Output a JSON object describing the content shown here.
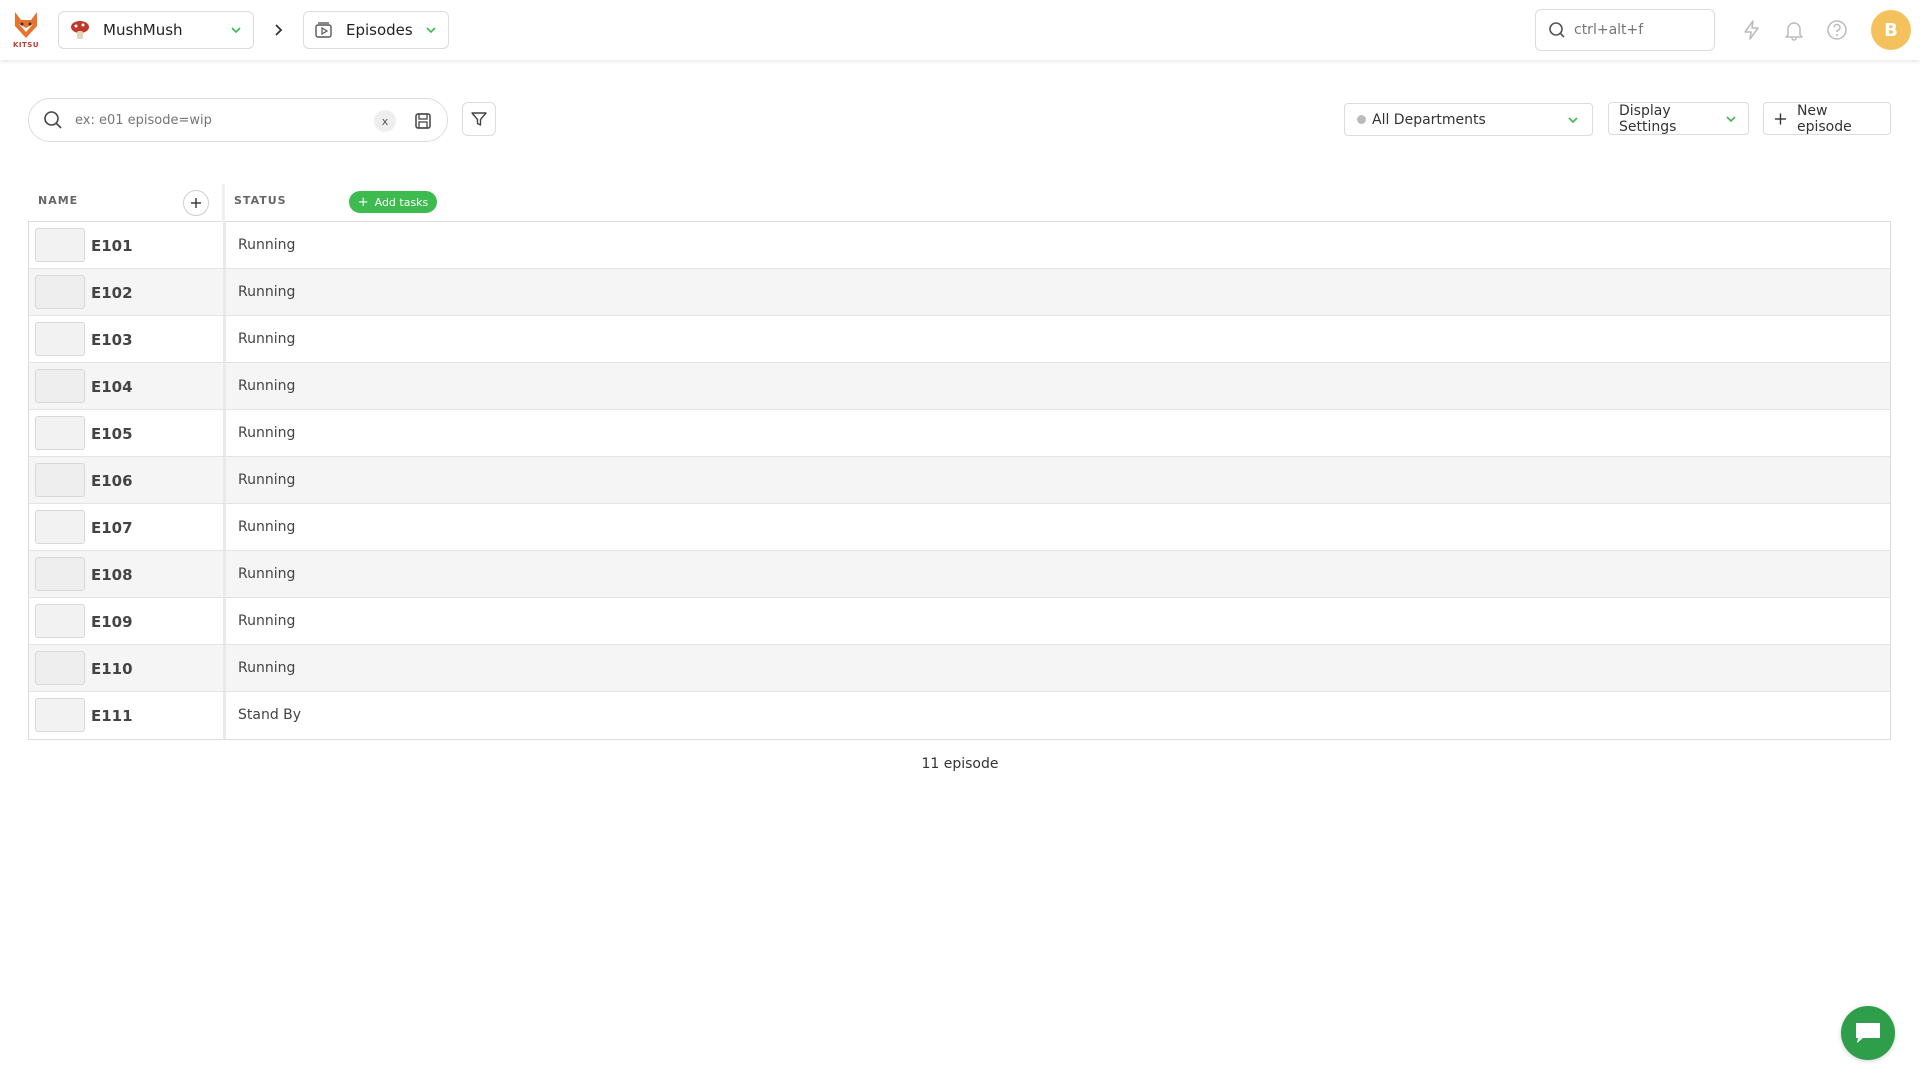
{
  "app": {
    "logo_text": "KITSU"
  },
  "breadcrumb": {
    "production": "MushMush",
    "section": "Episodes"
  },
  "global_search": {
    "placeholder": "ctrl+alt+f"
  },
  "user": {
    "avatar_initial": "B"
  },
  "toolbar": {
    "search_placeholder": "ex: e01 episode=wip",
    "clear_label": "x",
    "department": "All Departments",
    "display_settings": "Display Settings",
    "new_episode": "New episode"
  },
  "table": {
    "columns": {
      "name": "NAME",
      "status": "STATUS"
    },
    "add_tasks_label": "Add tasks",
    "rows": [
      {
        "name": "E101",
        "status": "Running"
      },
      {
        "name": "E102",
        "status": "Running"
      },
      {
        "name": "E103",
        "status": "Running"
      },
      {
        "name": "E104",
        "status": "Running"
      },
      {
        "name": "E105",
        "status": "Running"
      },
      {
        "name": "E106",
        "status": "Running"
      },
      {
        "name": "E107",
        "status": "Running"
      },
      {
        "name": "E108",
        "status": "Running"
      },
      {
        "name": "E109",
        "status": "Running"
      },
      {
        "name": "E110",
        "status": "Running"
      },
      {
        "name": "E111",
        "status": "Stand By"
      }
    ]
  },
  "footer": {
    "count": "11 episode"
  },
  "colors": {
    "accent_green": "#3dbb4f",
    "chat_green": "#2e9e4a",
    "avatar_yellow": "#f4c15d"
  },
  "icons": [
    "kitsu-logo-icon",
    "chevron-down-icon",
    "chevron-right-icon",
    "episodes-icon",
    "search-icon",
    "lightning-icon",
    "bell-icon",
    "help-icon",
    "save-icon",
    "filter-icon",
    "plus-icon",
    "chat-icon"
  ]
}
